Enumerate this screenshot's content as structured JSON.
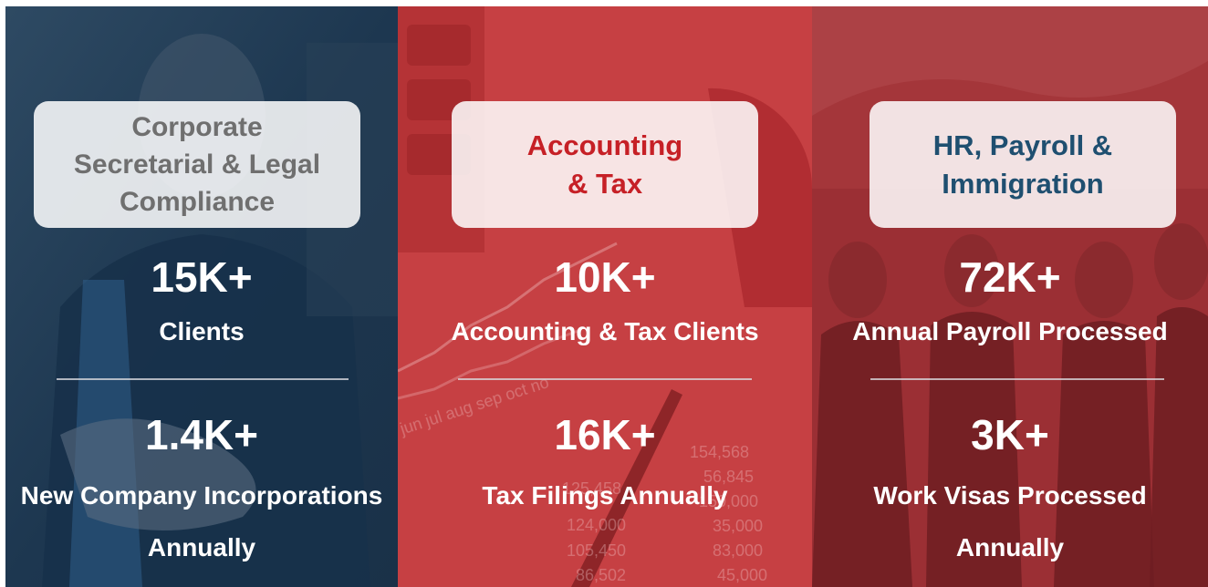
{
  "panels": [
    {
      "title": "Corporate Secretarial & Legal Compliance",
      "title_lines": [
        "Corporate",
        "Secretarial & Legal",
        "Compliance"
      ],
      "stat1_value": "15K+",
      "stat1_label": "Clients",
      "stat2_value": "1.4K+",
      "stat2_label_lines": [
        "New Company Incorporations",
        "Annually"
      ]
    },
    {
      "title": "Accounting & Tax",
      "title_lines": [
        "Accounting",
        "& Tax"
      ],
      "stat1_value": "10K+",
      "stat1_label": "Accounting & Tax Clients",
      "stat2_value": "16K+",
      "stat2_label_lines": [
        "Tax Filings Annually"
      ]
    },
    {
      "title": "HR, Payroll & Immigration",
      "title_lines": [
        "HR, Payroll &",
        "Immigration"
      ],
      "stat1_value": "72K+",
      "stat1_label": "Annual Payroll Processed",
      "stat2_value": "3K+",
      "stat2_label_lines": [
        "Work Visas Processed",
        "Annually"
      ]
    }
  ],
  "background_figures": [
    "154,568",
    "56,845",
    "150,000",
    "35,000",
    "83,000",
    "45,000",
    "125,458",
    "124,000",
    "105,450",
    "86,502"
  ],
  "background_months": "jun jul aug sep oct no",
  "colors": {
    "panel1": "#1f3a52",
    "panel2": "#c23a3b",
    "panel3": "#9a2e33",
    "title1": "#6f6f6f",
    "title2": "#c62026",
    "title3": "#1f4f70"
  }
}
